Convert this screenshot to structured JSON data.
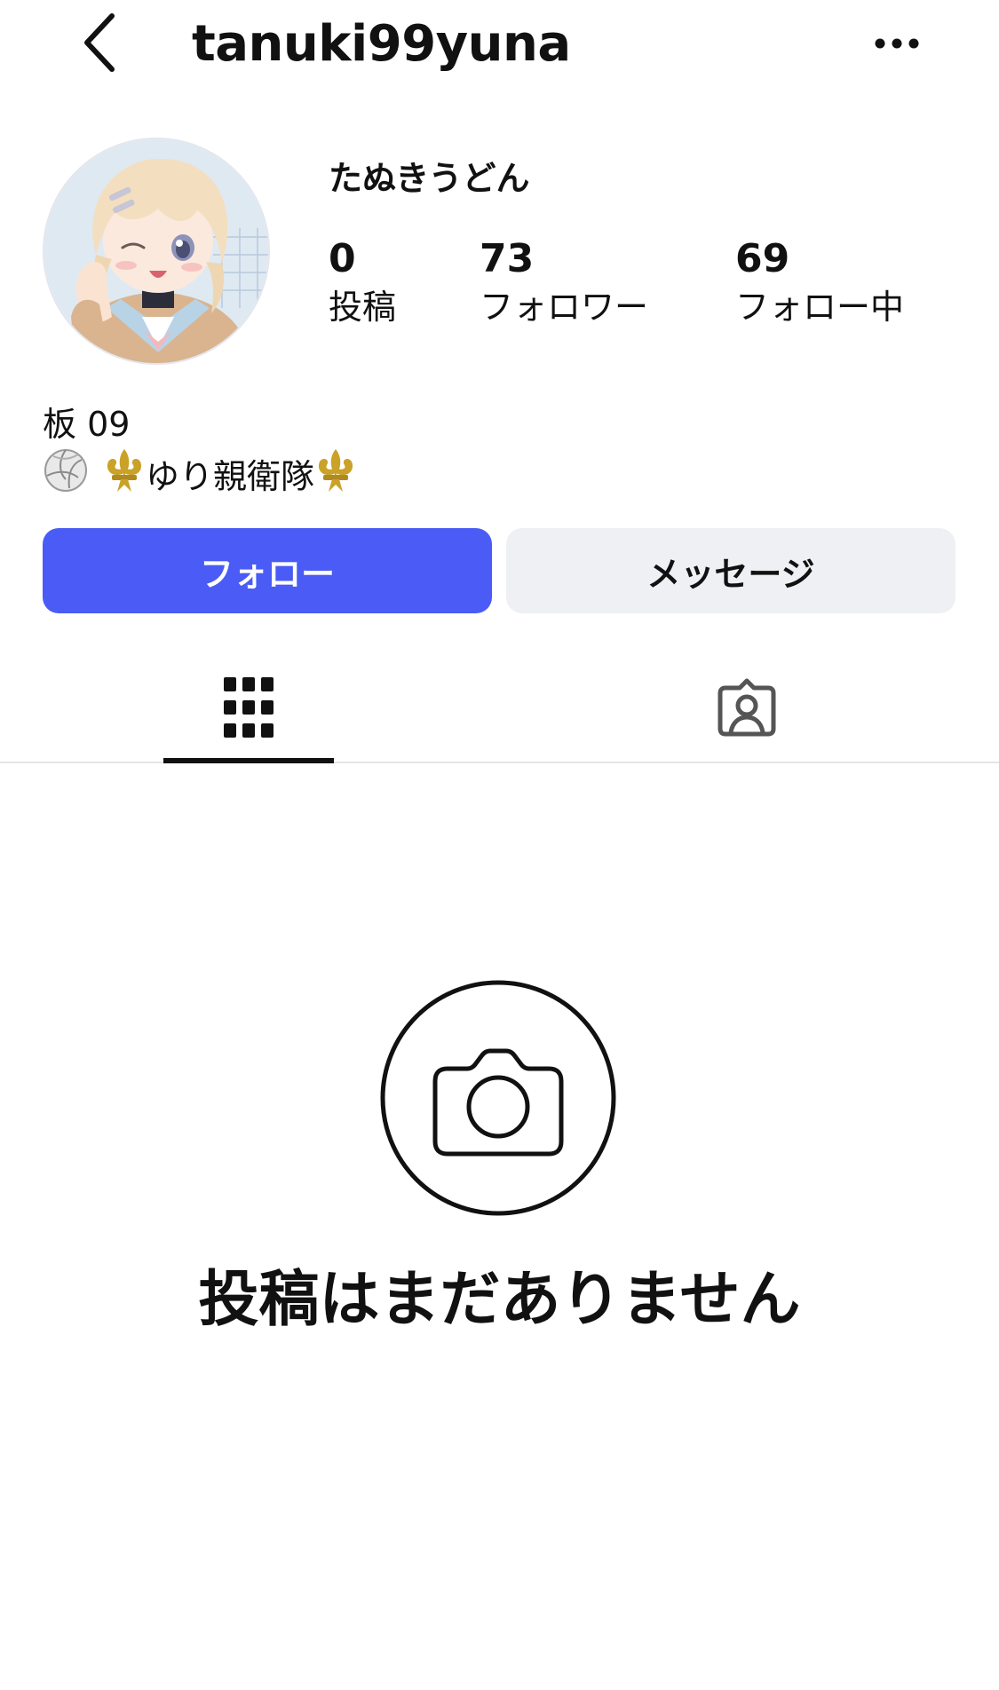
{
  "header": {
    "username": "tanuki99yuna",
    "back_icon": "chevron-left-icon",
    "more_icon": "more-horizontal-icon"
  },
  "profile": {
    "display_name": "たぬきうどん",
    "stats": [
      {
        "count": "0",
        "label": "投稿"
      },
      {
        "count": "73",
        "label": "フォロワー"
      },
      {
        "count": "69",
        "label": "フォロー中"
      }
    ],
    "bio_line1": "板 09",
    "bio_line2_text": "ゆり親衛隊",
    "bio_emojis": [
      "volleyball-emoji",
      "fleur-de-lis-emoji",
      "fleur-de-lis-emoji"
    ]
  },
  "actions": {
    "follow_label": "フォロー",
    "message_label": "メッセージ"
  },
  "tabs": [
    {
      "name": "posts-grid",
      "icon": "grid-icon",
      "active": true
    },
    {
      "name": "tagged",
      "icon": "tagged-person-icon",
      "active": false
    }
  ],
  "empty_state": {
    "icon": "camera-icon",
    "text": "投稿はまだありません"
  },
  "colors": {
    "follow_button": "#4a5cf5",
    "message_button": "#eff0f4",
    "fleur_de_lis": "#c9a227"
  }
}
